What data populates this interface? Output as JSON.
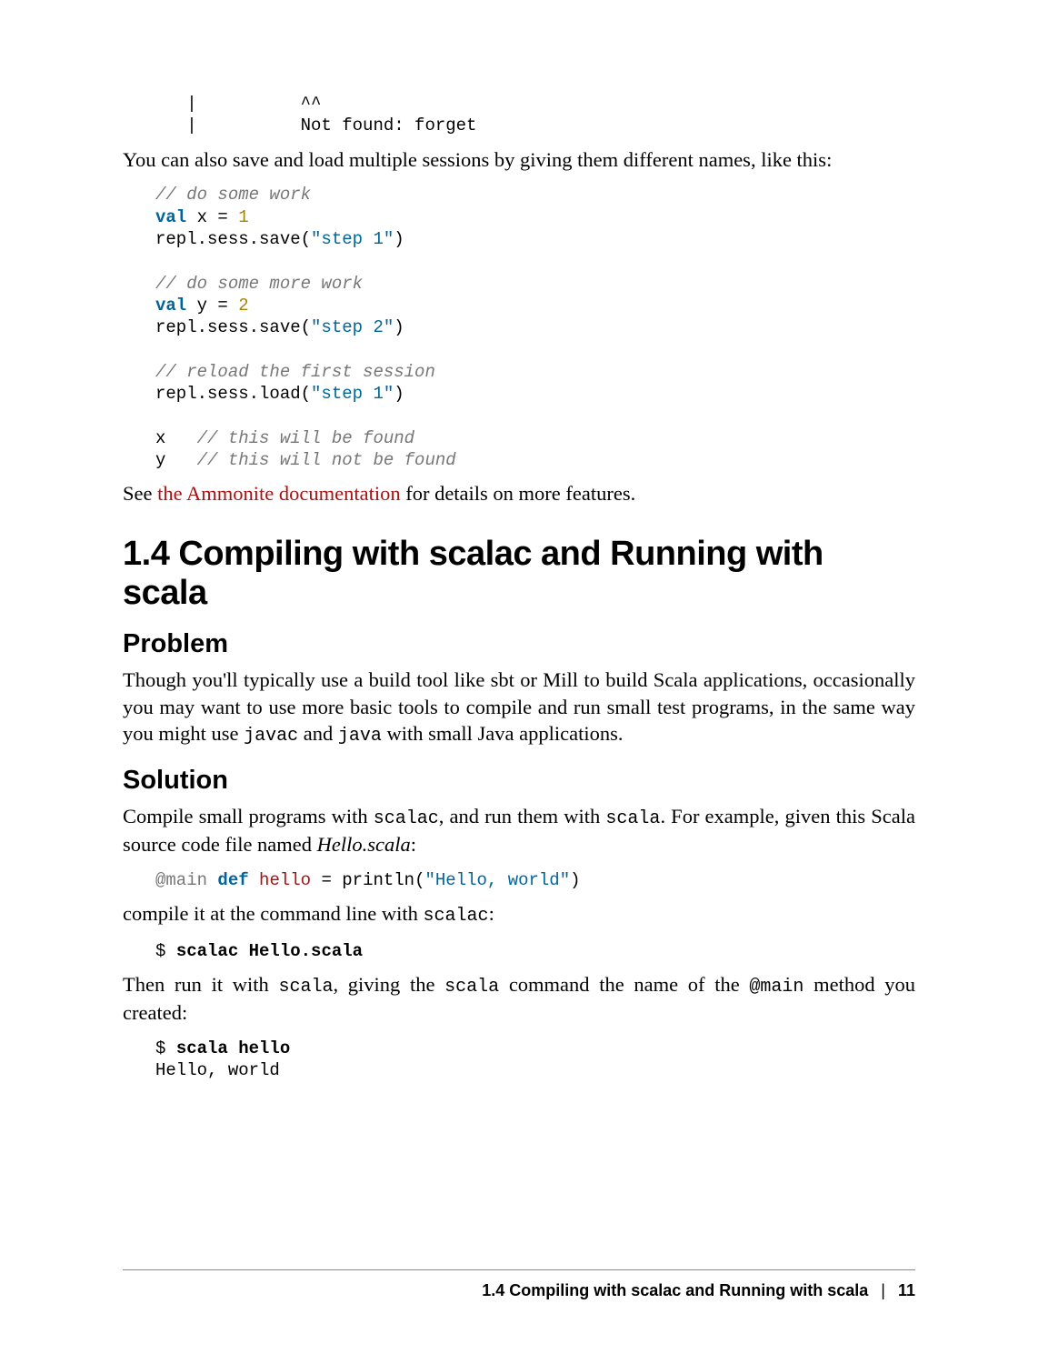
{
  "code1": {
    "l1": "   |          ^^",
    "l2": "   |          Not found: forget"
  },
  "para1": "You can also save and load multiple sessions by giving them different names, like this:",
  "code2": {
    "c1": "// do some work",
    "k1": "val",
    "id1": " x = ",
    "n1": "1",
    "l3a": "repl.sess.save(",
    "s1": "\"step 1\"",
    "l3b": ")",
    "c2": "// do some more work",
    "k2": "val",
    "id2": " y = ",
    "n2": "2",
    "l6a": "repl.sess.save(",
    "s2": "\"step 2\"",
    "l6b": ")",
    "c3": "// reload the first session",
    "l8a": "repl.sess.load(",
    "s3": "\"step 1\"",
    "l8b": ")",
    "l9a": "x   ",
    "c4": "// this will be found",
    "l10a": "y   ",
    "c5": "// this will not be found"
  },
  "para2_a": "See ",
  "para2_link": "the Ammonite documentation",
  "para2_b": " for details on more features.",
  "h1": "1.4 Compiling with scalac and Running with scala",
  "h2a": "Problem",
  "para3_a": "Though you'll typically use a build tool like sbt or Mill to build Scala applications, occasionally you may want to use more basic tools to compile and run small test programs, in the same way you might use ",
  "para3_m1": "javac",
  "para3_b": " and ",
  "para3_m2": "java",
  "para3_c": " with small Java applications.",
  "h2b": "Solution",
  "para4_a": "Compile small programs with ",
  "para4_m1": "scalac",
  "para4_b": ", and run them with ",
  "para4_m2": "scala",
  "para4_c": ". For example, given this Scala source code file named ",
  "para4_i": "Hello.scala",
  "para4_d": ":",
  "code3": {
    "anno": "@main",
    "sp1": " ",
    "kw": "def",
    "sp2": " ",
    "name": "hello",
    "mid": " = println(",
    "str": "\"Hello, world\"",
    "end": ")"
  },
  "para5_a": "compile it at the command line with ",
  "para5_m1": "scalac",
  "para5_b": ":",
  "code4": {
    "prompt": "$ ",
    "cmd": "scalac Hello.scala"
  },
  "para6_a": "Then run it with ",
  "para6_m1": "scala",
  "para6_b": ", giving the ",
  "para6_m2": "scala",
  "para6_c": " command the name of the ",
  "para6_m3": "@main",
  "para6_d": " method you created:",
  "code5": {
    "prompt": "$ ",
    "cmd": "scala hello",
    "out": "Hello, world"
  },
  "footer": {
    "title": "1.4 Compiling with scalac and Running with scala",
    "sep": "|",
    "page": "11"
  }
}
